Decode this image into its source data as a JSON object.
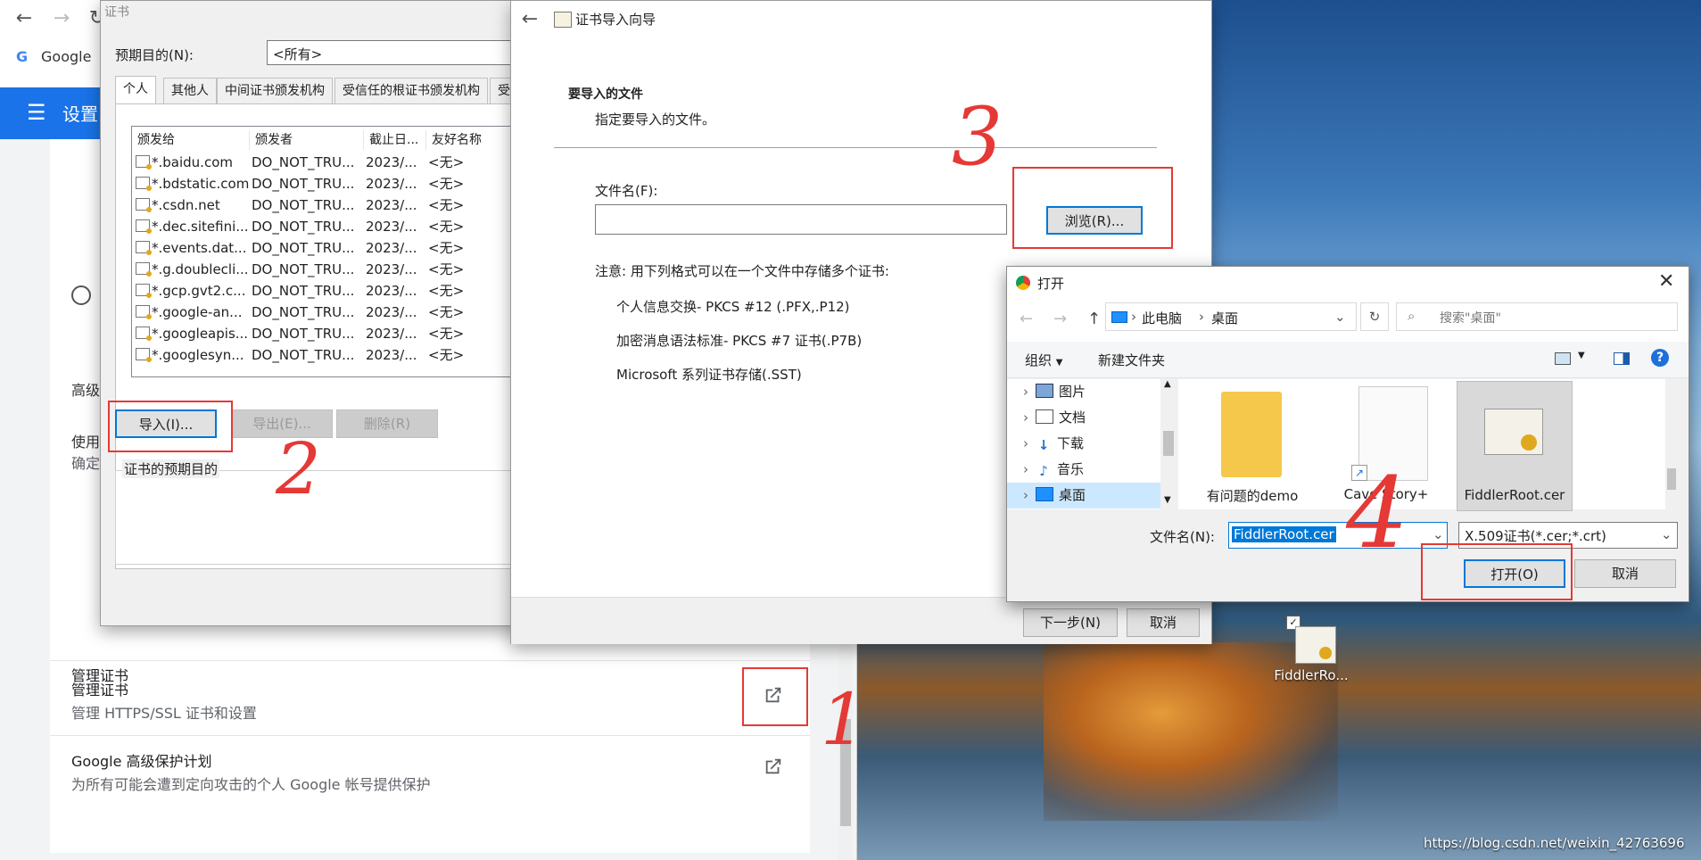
{
  "chrome": {
    "tab_google_label": "Google",
    "header_title": "设置",
    "advanced_label": "高级",
    "use_label": "使用",
    "confirm_label": "确定",
    "manage_cert": {
      "title": "管理证书",
      "subtitle": "管理 HTTPS/SSL 证书和设置"
    },
    "advanced_protection": {
      "title": "Google 高级保护计划",
      "subtitle": "为所有可能会遭到定向攻击的个人 Google 帐号提供保护"
    }
  },
  "cert_manager": {
    "title": "证书",
    "purpose_label": "预期目的(N):",
    "purpose_value": "<所有>",
    "tabs": [
      "个人",
      "其他人",
      "中间证书颁发机构",
      "受信任的根证书颁发机构",
      "受"
    ],
    "columns": [
      "颁发给",
      "颁发者",
      "截止日...",
      "友好名称"
    ],
    "rows": [
      [
        "*.baidu.com",
        "DO_NOT_TRU...",
        "2023/...",
        "<无>"
      ],
      [
        "*.bdstatic.com",
        "DO_NOT_TRU...",
        "2023/...",
        "<无>"
      ],
      [
        "*.csdn.net",
        "DO_NOT_TRU...",
        "2023/...",
        "<无>"
      ],
      [
        "*.dec.sitefini...",
        "DO_NOT_TRU...",
        "2023/...",
        "<无>"
      ],
      [
        "*.events.dat...",
        "DO_NOT_TRU...",
        "2023/...",
        "<无>"
      ],
      [
        "*.g.doublecli...",
        "DO_NOT_TRU...",
        "2023/...",
        "<无>"
      ],
      [
        "*.gcp.gvt2.c...",
        "DO_NOT_TRU...",
        "2023/...",
        "<无>"
      ],
      [
        "*.google-an...",
        "DO_NOT_TRU...",
        "2023/...",
        "<无>"
      ],
      [
        "*.googleapis...",
        "DO_NOT_TRU...",
        "2023/...",
        "<无>"
      ],
      [
        "*.googlesyn...",
        "DO_NOT_TRU...",
        "2023/...",
        "<无>"
      ]
    ],
    "import_button": "导入(I)...",
    "export_button": "导出(E)...",
    "delete_button": "删除(R)",
    "purpose_group_label": "证书的预期目的"
  },
  "wizard": {
    "title": "证书导入向导",
    "section_title": "要导入的文件",
    "section_subtitle": "指定要导入的文件。",
    "filename_label": "文件名(F):",
    "filename_value": "",
    "browse_button": "浏览(R)...",
    "note": "注意: 用下列格式可以在一个文件中存储多个证书:",
    "formats": [
      "个人信息交换- PKCS #12 (.PFX,.P12)",
      "加密消息语法标准- PKCS #7 证书(.P7B)",
      "Microsoft 系列证书存储(.SST)"
    ],
    "next_button": "下一步(N)",
    "cancel_button": "取消"
  },
  "open_dialog": {
    "title": "打开",
    "breadcrumb": [
      "此电脑",
      "桌面"
    ],
    "search_placeholder": "搜索\"桌面\"",
    "organize_label": "组织",
    "new_folder_label": "新建文件夹",
    "tree": [
      "图片",
      "文档",
      "下载",
      "音乐",
      "桌面"
    ],
    "files": [
      "有问题的demo",
      "Cave Story+",
      "FiddlerRoot.cer"
    ],
    "filename_label": "文件名(N):",
    "filename_value": "FiddlerRoot.cer",
    "filetype_value": "X.509证书(*.cer;*.crt)",
    "open_button": "打开(O)",
    "cancel_button": "取消"
  },
  "desktop": {
    "icon_label": "FiddlerRo...",
    "watermark": "https://blog.csdn.net/weixin_42763696"
  },
  "annotations": [
    "1",
    "2",
    "3",
    "4"
  ],
  "colors": {
    "chrome_blue": "#1a73e8",
    "annotation_red": "#e53935",
    "selection_blue": "#0078d7"
  }
}
